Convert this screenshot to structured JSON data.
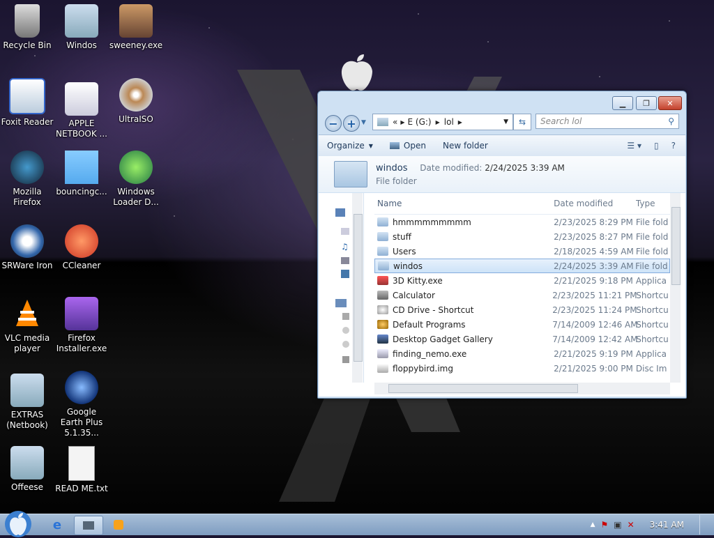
{
  "desktop": {
    "icons": [
      {
        "label": "Recycle Bin",
        "icon": "recycle-bin-icon"
      },
      {
        "label": "Windos",
        "icon": "folder-icon"
      },
      {
        "label": "sweeney.exe",
        "icon": "photo-icon"
      },
      {
        "label": "Foxit Reader",
        "icon": "foxit-icon"
      },
      {
        "label": "APPLE NETBOOK ...",
        "icon": "document-stack-icon"
      },
      {
        "label": "UltraISO",
        "icon": "disc-icon"
      },
      {
        "label": "Mozilla Firefox",
        "icon": "firefox-icon"
      },
      {
        "label": "bouncingc...",
        "icon": "minecraft-icon"
      },
      {
        "label": "Windows Loader D...",
        "icon": "windows-orb-icon"
      },
      {
        "label": "SRWare Iron",
        "icon": "iron-browser-icon"
      },
      {
        "label": "CCleaner",
        "icon": "ccleaner-icon"
      },
      {
        "label": "VLC media player",
        "icon": "vlc-cone-icon"
      },
      {
        "label": "Firefox Installer.exe",
        "icon": "installer-box-icon"
      },
      {
        "label": "EXTRAS (Netbook)",
        "icon": "folder-icon"
      },
      {
        "label": "Google Earth Plus 5.1.35...",
        "icon": "globe-icon"
      },
      {
        "label": "Offeese",
        "icon": "folder-icon"
      },
      {
        "label": "READ ME.txt",
        "icon": "text-file-icon"
      }
    ]
  },
  "explorer": {
    "breadcrumb": {
      "prefix": "«",
      "drive": "E (G:)",
      "folder": "lol"
    },
    "search_placeholder": "Search lol",
    "toolbar": {
      "organize": "Organize",
      "open": "Open",
      "new_folder": "New folder"
    },
    "details": {
      "name": "windos",
      "date_label": "Date modified:",
      "date_value": "2/24/2025 3:39 AM",
      "type": "File folder"
    },
    "columns": {
      "name": "Name",
      "date": "Date modified",
      "type": "Type"
    },
    "files": [
      {
        "name": "hmmmmmmmmm",
        "date": "2/23/2025 8:29 PM",
        "type": "File fold",
        "icon": "folder-icon"
      },
      {
        "name": "stuff",
        "date": "2/23/2025 8:27 PM",
        "type": "File fold",
        "icon": "folder-icon"
      },
      {
        "name": "Users",
        "date": "2/18/2025 4:59 AM",
        "type": "File fold",
        "icon": "folder-icon"
      },
      {
        "name": "windos",
        "date": "2/24/2025 3:39 AM",
        "type": "File fold",
        "icon": "folder-icon",
        "selected": true
      },
      {
        "name": "3D Kitty.exe",
        "date": "2/21/2025 9:18 PM",
        "type": "Applica",
        "icon": "kitty-app-icon"
      },
      {
        "name": "Calculator",
        "date": "2/23/2025 11:21 PM",
        "type": "Shortcu",
        "icon": "calculator-icon"
      },
      {
        "name": "CD Drive - Shortcut",
        "date": "2/23/2025 11:24 PM",
        "type": "Shortcu",
        "icon": "cd-drive-icon"
      },
      {
        "name": "Default Programs",
        "date": "7/14/2009 12:46 AM",
        "type": "Shortcu",
        "icon": "default-programs-icon"
      },
      {
        "name": "Desktop Gadget Gallery",
        "date": "7/14/2009 12:42 AM",
        "type": "Shortcu",
        "icon": "gadget-icon"
      },
      {
        "name": "finding_nemo.exe",
        "date": "2/21/2025 9:19 PM",
        "type": "Applica",
        "icon": "exe-icon"
      },
      {
        "name": "floppybird.img",
        "date": "2/21/2025 9:00 PM",
        "type": "Disc Im",
        "icon": "disc-image-icon"
      }
    ]
  },
  "taskbar": {
    "clock": "3:41 AM"
  }
}
